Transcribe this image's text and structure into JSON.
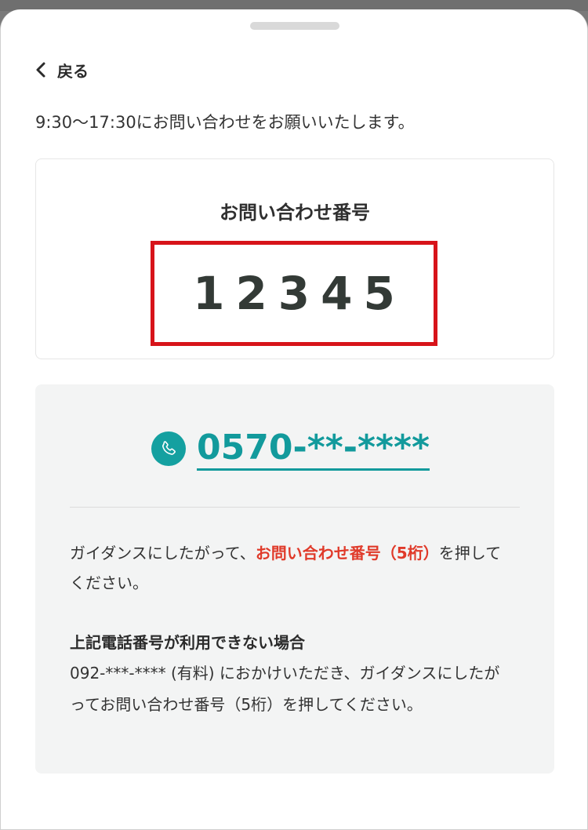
{
  "header": {
    "back_label": "戻る"
  },
  "notice": "9:30〜17:30にお問い合わせをお願いいたします。",
  "inquiry_number": {
    "title": "お問い合わせ番号",
    "value": "12345"
  },
  "contact": {
    "phone_number": "0570-**-****",
    "guide_prefix": "ガイダンスにしたがって、",
    "guide_accent": "お問い合わせ番号（5桁）",
    "guide_suffix": "を押してください。",
    "alt_heading": "上記電話番号が利用できない場合",
    "alt_body": "092-***-**** (有料) におかけいただき、ガイダンスにしたがってお問い合わせ番号（5桁）を押してください。"
  },
  "colors": {
    "accent_teal": "#129a9c",
    "highlight_red": "#d7141a",
    "emphasis_red": "#e03a2a"
  }
}
